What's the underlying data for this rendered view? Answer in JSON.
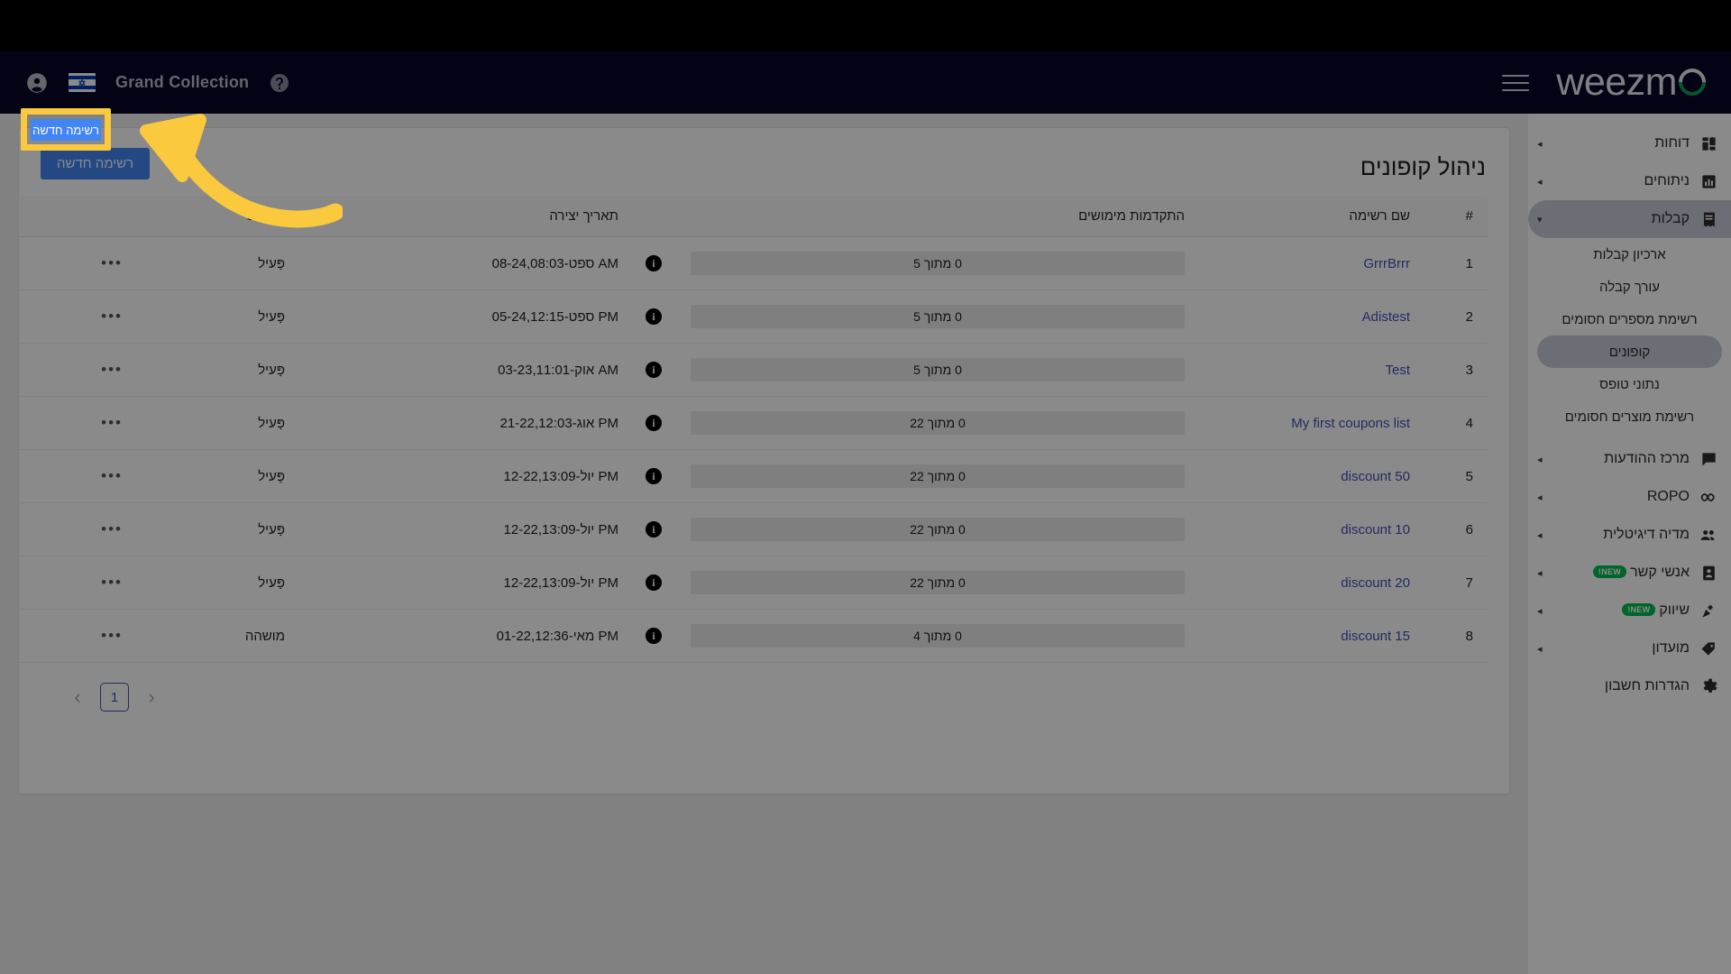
{
  "navbar": {
    "account_icon": "account-circle-icon",
    "flag_icon": "israel-flag-icon",
    "brand": "Grand Collection",
    "help_icon": "help-circle-icon",
    "menu_icon": "hamburger-menu-icon",
    "logo": "weezm"
  },
  "sidebar": {
    "items": [
      {
        "label": "דוחות",
        "icon": "dashboard-icon",
        "arrow": "◂",
        "active": false,
        "badge": ""
      },
      {
        "label": "ניתוחים",
        "icon": "analytics-icon",
        "arrow": "◂",
        "active": false,
        "badge": ""
      },
      {
        "label": "קבלות",
        "icon": "receipt-icon",
        "arrow": "▾",
        "active": true,
        "badge": ""
      }
    ],
    "sub_items": [
      {
        "label": "ארכיון קבלות",
        "active": false
      },
      {
        "label": "עורך קבלה",
        "active": false
      },
      {
        "label": "רשימת מספרים חסומים",
        "active": false
      },
      {
        "label": "קופונים",
        "active": true
      },
      {
        "label": "נתוני טופס",
        "active": false
      },
      {
        "label": "רשימת מוצרים חסומים",
        "active": false
      }
    ],
    "items2": [
      {
        "label": "מרכז ההודעות",
        "icon": "chat-icon",
        "arrow": "◂",
        "badge": ""
      },
      {
        "label": "ROPO",
        "icon": "infinity-icon",
        "arrow": "◂",
        "badge": ""
      },
      {
        "label": "מדיה דיגיטלית",
        "icon": "group-icon",
        "arrow": "◂",
        "badge": ""
      },
      {
        "label": "אנשי קשר",
        "icon": "contacts-icon",
        "arrow": "◂",
        "badge": "NEW!"
      },
      {
        "label": "שיווק",
        "icon": "megaphone-icon",
        "arrow": "◂",
        "badge": "NEW!"
      },
      {
        "label": "מועדון",
        "icon": "tag-icon",
        "arrow": "◂",
        "badge": ""
      },
      {
        "label": "הגדרות חשבון",
        "icon": "gear-icon",
        "arrow": "",
        "badge": ""
      }
    ]
  },
  "main": {
    "page_title": "ניהול קופונים",
    "new_list_button": "רשימה חדשה",
    "table": {
      "headers": {
        "num": "#",
        "name": "שם רשימה",
        "progress": "התקדמות מימושים",
        "date": "תאריך יצירה",
        "status": "סטטוס",
        "menu": ""
      },
      "rows": [
        {
          "num": "1",
          "name": "GrrrBrrr",
          "progress": "0 מתוך 5",
          "percent": 0,
          "info": "i",
          "date": "08-ספט-24,08:03 AM",
          "status": "פָּעיל",
          "menu": "•••"
        },
        {
          "num": "2",
          "name": "Adistest",
          "progress": "0 מתוך 5",
          "percent": 0,
          "info": "i",
          "date": "05-ספט-24,12:15 PM",
          "status": "פָּעיל",
          "menu": "•••"
        },
        {
          "num": "3",
          "name": "Test",
          "progress": "0 מתוך 5",
          "percent": 0,
          "info": "i",
          "date": "03-אוק-23,11:01 AM",
          "status": "פָּעיל",
          "menu": "•••"
        },
        {
          "num": "4",
          "name": "My first coupons list",
          "progress": "0 מתוך 22",
          "percent": 0,
          "info": "i",
          "date": "21-אוג-22,12:03 PM",
          "status": "פָּעיל",
          "menu": "•••"
        },
        {
          "num": "5",
          "name": "discount 50",
          "progress": "0 מתוך 22",
          "percent": 0,
          "info": "i",
          "date": "12-יול-22,13:09 PM",
          "status": "פָּעיל",
          "menu": "•••"
        },
        {
          "num": "6",
          "name": "discount 10",
          "progress": "0 מתוך 22",
          "percent": 0,
          "info": "i",
          "date": "12-יול-22,13:09 PM",
          "status": "פָּעיל",
          "menu": "•••"
        },
        {
          "num": "7",
          "name": "discount 20",
          "progress": "0 מתוך 22",
          "percent": 0,
          "info": "i",
          "date": "12-יול-22,13:09 PM",
          "status": "פָּעיל",
          "menu": "•••"
        },
        {
          "num": "8",
          "name": "discount 15",
          "progress": "0 מתוך 4",
          "percent": 0,
          "info": "i",
          "date": "01-מאי-22,12:36 PM",
          "status": "מושהה",
          "menu": "•••"
        }
      ]
    },
    "pagination": {
      "prev": "‹",
      "current_page": "1",
      "next": "›"
    }
  },
  "annotation": {
    "highlight_target": "רשימה חדשה",
    "highlight_color": "#FBC93D",
    "arrow_icon": "curved-arrow-pointing-left"
  }
}
